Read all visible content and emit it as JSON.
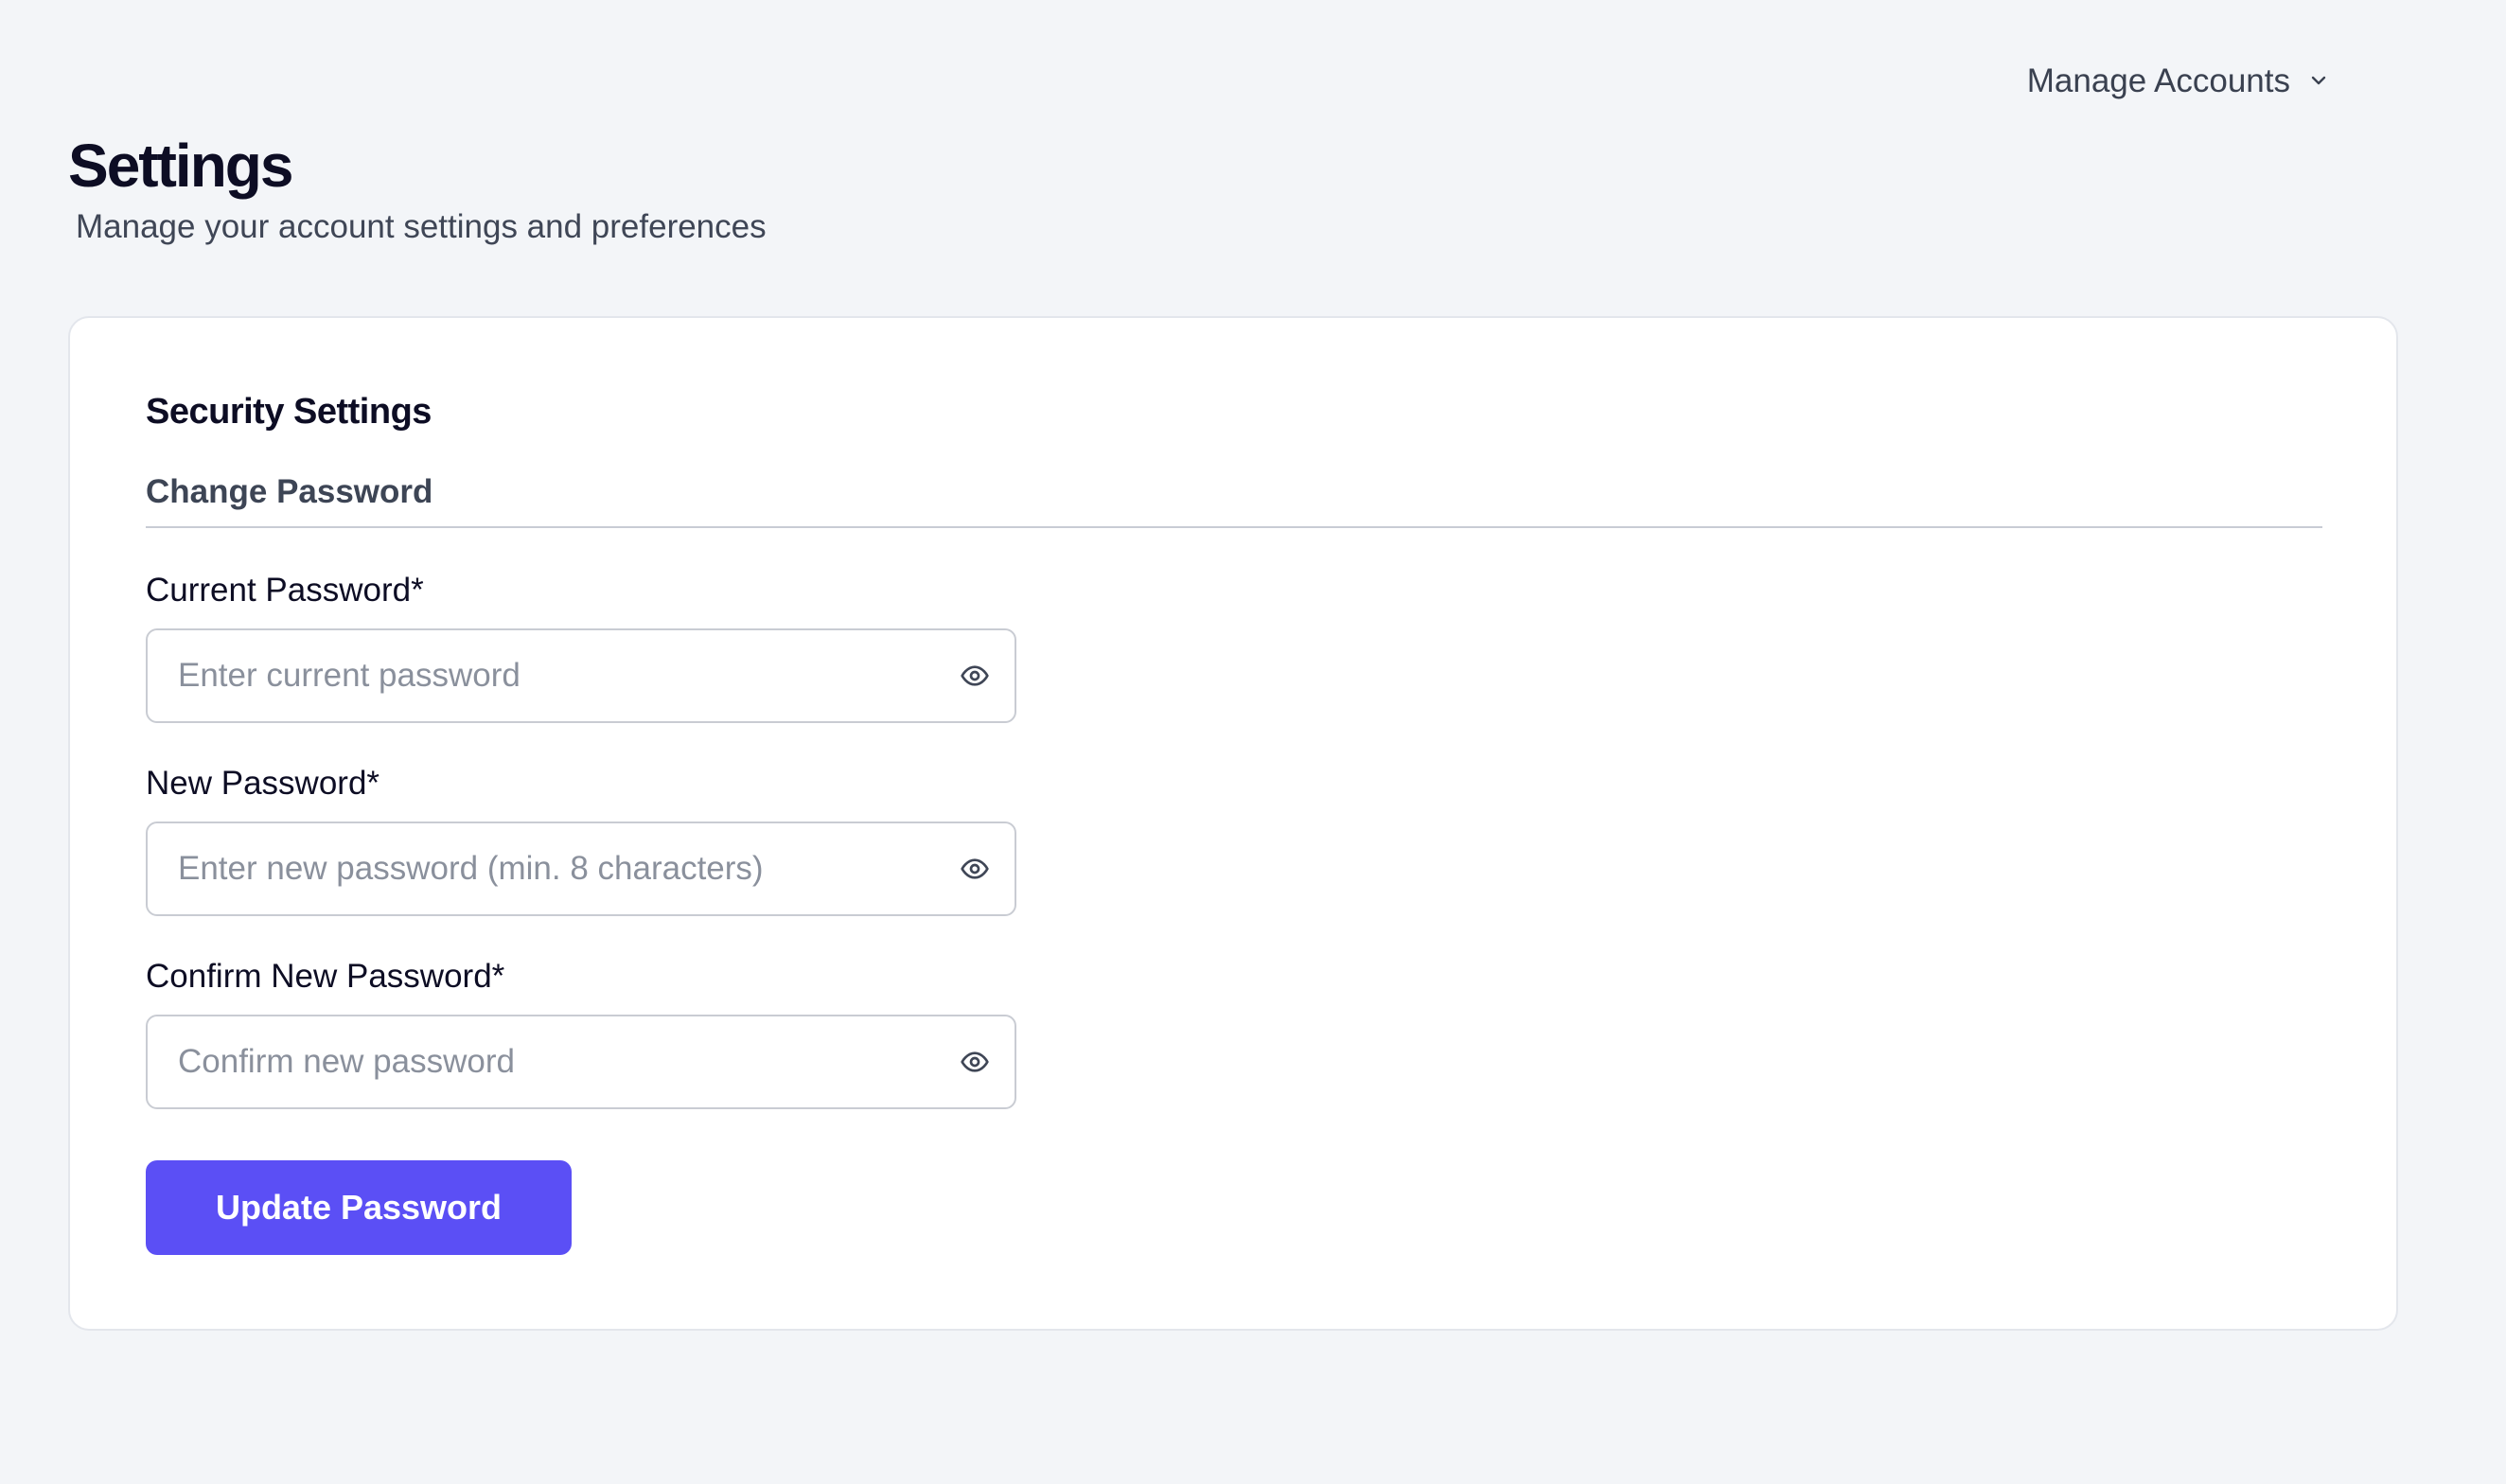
{
  "header": {
    "manage_accounts_label": "Manage Accounts",
    "title": "Settings",
    "subtitle": "Manage your account settings and preferences"
  },
  "card": {
    "section_title": "Security Settings",
    "subsection_title": "Change Password",
    "fields": [
      {
        "label": "Current Password*",
        "placeholder": "Enter current password",
        "value": ""
      },
      {
        "label": "New Password*",
        "placeholder": "Enter new password (min. 8 characters)",
        "value": ""
      },
      {
        "label": "Confirm New Password*",
        "placeholder": "Confirm new password",
        "value": ""
      }
    ],
    "submit_label": "Update Password"
  },
  "colors": {
    "background": "#f3f5f8",
    "card": "#ffffff",
    "accent": "#5b4ff5",
    "text_primary": "#0d0d24",
    "text_secondary": "#3f4656",
    "placeholder": "#8a909c"
  },
  "icons": {
    "dropdown": "chevron-down-icon",
    "password_toggle": "eye-icon"
  }
}
